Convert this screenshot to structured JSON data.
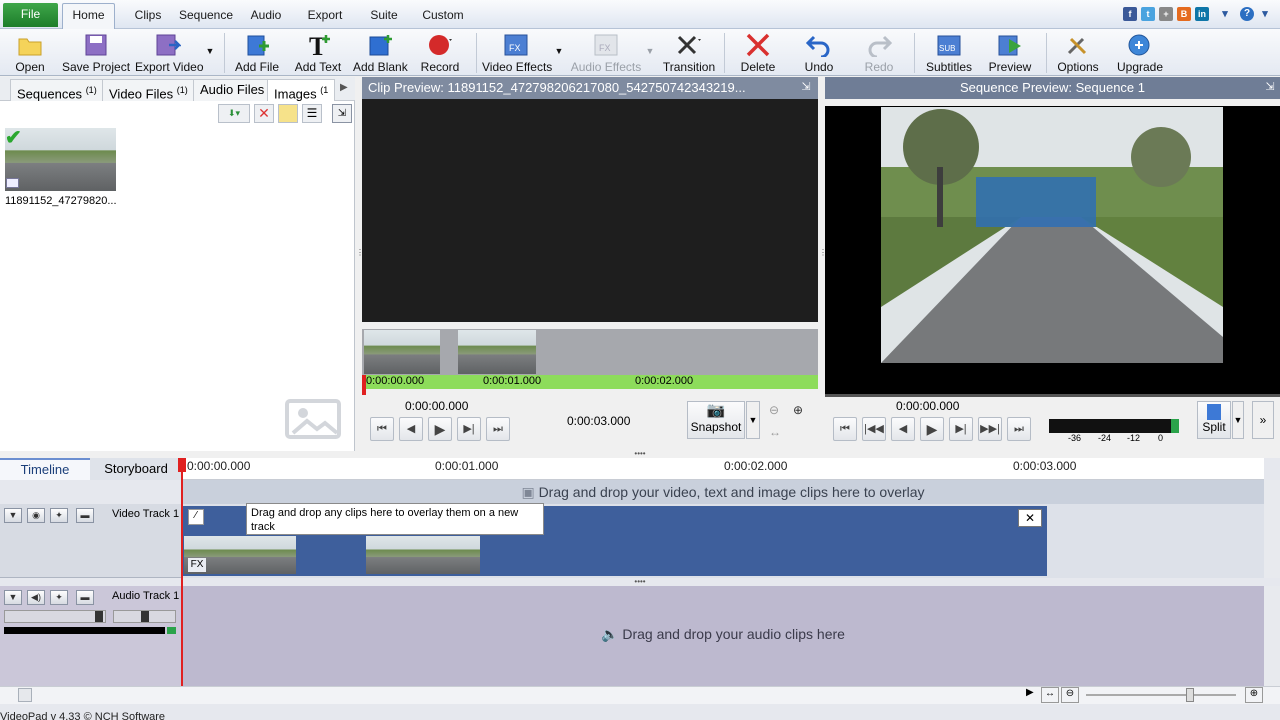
{
  "menu": {
    "file": "File",
    "tabs": [
      "Home",
      "Clips",
      "Sequence",
      "Audio",
      "Export",
      "Suite",
      "Custom"
    ]
  },
  "toolbar": {
    "open": "Open",
    "save_project": "Save Project",
    "export_video": "Export Video",
    "add_file": "Add File",
    "add_text": "Add Text",
    "add_blank": "Add Blank",
    "record": "Record",
    "video_effects": "Video Effects",
    "audio_effects": "Audio Effects",
    "transition": "Transition",
    "delete": "Delete",
    "undo": "Undo",
    "redo": "Redo",
    "subtitles": "Subtitles",
    "preview": "Preview",
    "options": "Options",
    "upgrade": "Upgrade"
  },
  "bin": {
    "tabs": [
      {
        "label": "Sequences",
        "count": "(1)"
      },
      {
        "label": "Video Files",
        "count": "(1)"
      },
      {
        "label": "Audio Files",
        "count": ""
      },
      {
        "label": "Images",
        "count": "(1"
      }
    ],
    "file_name": "11891152_47279820..."
  },
  "clip_preview": {
    "title": "Clip Preview: 11891152_472798206217080_542750742343219...",
    "time_marks": [
      "0:00:00.000",
      "0:00:01.000",
      "0:00:02.000"
    ],
    "current_time": "0:00:00.000",
    "duration": "0:00:03.000",
    "snapshot": "Snapshot"
  },
  "sequence_preview": {
    "title": "Sequence Preview: Sequence 1",
    "current_time": "0:00:00.000",
    "meter_labels": [
      "-36",
      "-24",
      "-12",
      "0"
    ],
    "split": "Split"
  },
  "timeline": {
    "tab_timeline": "Timeline",
    "tab_storyboard": "Storyboard",
    "ruler": [
      "0:00:00.000",
      "0:00:01.000",
      "0:00:02.000",
      "0:00:03.000"
    ],
    "overlay_hint": "Drag and drop your video, text and image clips here to overlay",
    "video_track": "Video Track 1",
    "tooltip": "Drag and drop any clips here to overlay them on a new track",
    "fx_badge": "FX",
    "audio_track": "Audio Track 1",
    "audio_hint": "Drag and drop your audio clips here"
  },
  "status": "VideoPad v 4.33 © NCH Software",
  "colors": {
    "accent": "#3e5f9c",
    "file_menu": "#2a8f37",
    "audio_bg": "#bdb9cf"
  }
}
